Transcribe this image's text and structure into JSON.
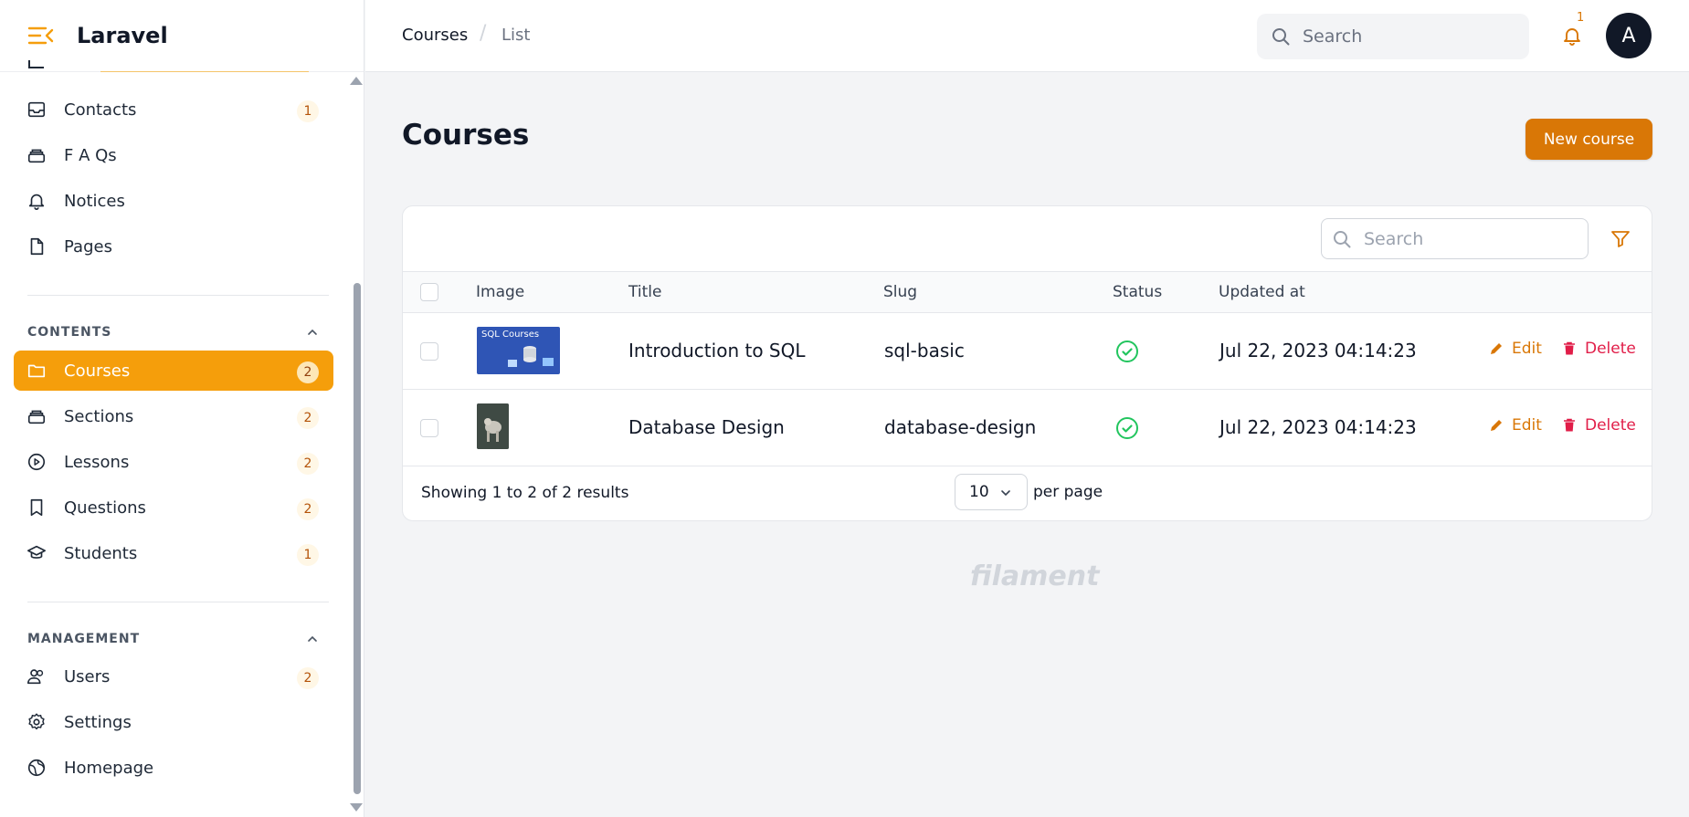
{
  "app": {
    "brand": "Laravel"
  },
  "topbar": {
    "breadcrumbs": [
      "Courses",
      "List"
    ],
    "breadcrumb_separator": "/",
    "search_placeholder": "Search",
    "notification_count": "1",
    "avatar_initial": "A"
  },
  "sidebar": {
    "items_top": [
      {
        "label": "Contacts",
        "badge": "1",
        "icon": "inbox-icon"
      },
      {
        "label": "F A Qs",
        "badge": "",
        "icon": "stack-icon"
      },
      {
        "label": "Notices",
        "badge": "",
        "icon": "bell-icon"
      },
      {
        "label": "Pages",
        "badge": "",
        "icon": "document-icon"
      }
    ],
    "groups": [
      {
        "title": "CONTENTS",
        "items": [
          {
            "label": "Courses",
            "badge": "2",
            "icon": "folder-icon",
            "active": true
          },
          {
            "label": "Sections",
            "badge": "2",
            "icon": "stack-icon"
          },
          {
            "label": "Lessons",
            "badge": "2",
            "icon": "play-circle-icon"
          },
          {
            "label": "Questions",
            "badge": "2",
            "icon": "bookmark-icon"
          },
          {
            "label": "Students",
            "badge": "1",
            "icon": "graduation-cap-icon"
          }
        ]
      },
      {
        "title": "MANAGEMENT",
        "items": [
          {
            "label": "Users",
            "badge": "2",
            "icon": "users-icon"
          },
          {
            "label": "Settings",
            "badge": "",
            "icon": "gear-icon"
          },
          {
            "label": "Homepage",
            "badge": "",
            "icon": "globe-icon"
          }
        ]
      }
    ]
  },
  "page": {
    "title": "Courses",
    "new_button": "New course"
  },
  "table": {
    "search_placeholder": "Search",
    "columns": [
      "Image",
      "Title",
      "Slug",
      "Status",
      "Updated at"
    ],
    "rows": [
      {
        "image_text": "SQL Courses",
        "title": "Introduction to SQL",
        "slug": "sql-basic",
        "status": "published",
        "updated_at": "Jul 22, 2023 04:14:23"
      },
      {
        "image_text": "",
        "title": "Database Design",
        "slug": "database-design",
        "status": "published",
        "updated_at": "Jul 22, 2023 04:14:23"
      }
    ],
    "actions": {
      "edit": "Edit",
      "delete": "Delete"
    },
    "footer": {
      "summary": "Showing 1 to 2 of 2 results",
      "per_page_value": "10",
      "per_page_label": "per page"
    }
  },
  "footer_brand": "filament",
  "colors": {
    "primary": "#f59e0b",
    "primary_dark": "#d97706",
    "danger": "#e11d48",
    "success": "#22c55e"
  }
}
